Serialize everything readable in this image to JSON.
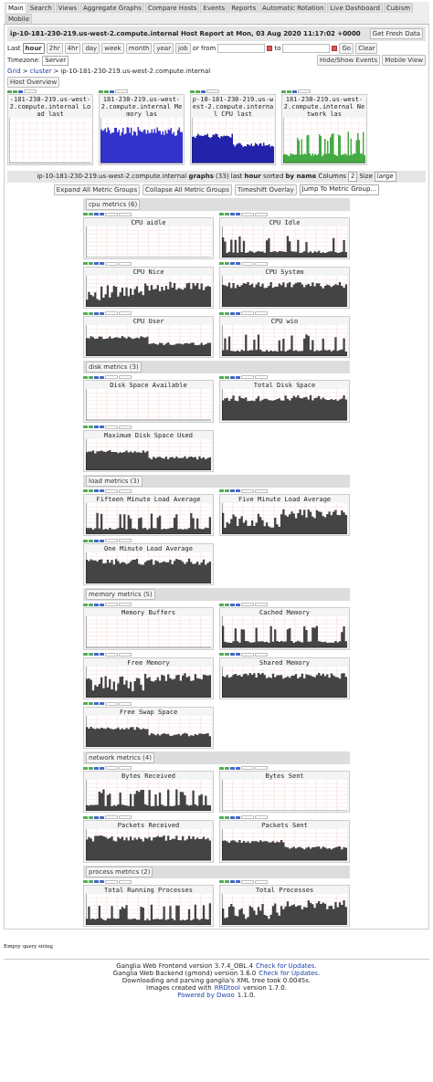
{
  "tabs": [
    {
      "label": "Main",
      "selected": true
    },
    {
      "label": "Search",
      "selected": false
    },
    {
      "label": "Views",
      "selected": false
    },
    {
      "label": "Aggregate Graphs",
      "selected": false
    },
    {
      "label": "Compare Hosts",
      "selected": false
    },
    {
      "label": "Events",
      "selected": false
    },
    {
      "label": "Reports",
      "selected": false
    },
    {
      "label": "Automatic Rotation",
      "selected": false
    },
    {
      "label": "Live Dashboard",
      "selected": false
    },
    {
      "label": "Cubism",
      "selected": false
    },
    {
      "label": "Mobile",
      "selected": false
    }
  ],
  "header": {
    "title": "ip-10-181-230-219.us-west-2.compute.internal Host Report at Mon, 03 Aug 2020 11:17:02 +0000",
    "refresh_button": "Get Fresh Data"
  },
  "range": {
    "label": "Last",
    "options": [
      {
        "label": "hour",
        "selected": true
      },
      {
        "label": "2hr",
        "selected": false
      },
      {
        "label": "4hr",
        "selected": false
      },
      {
        "label": "day",
        "selected": false
      },
      {
        "label": "week",
        "selected": false
      },
      {
        "label": "month",
        "selected": false
      },
      {
        "label": "year",
        "selected": false
      },
      {
        "label": "job",
        "selected": false
      }
    ],
    "from_label": "or from",
    "to_label": "to",
    "go_button": "Go",
    "clear_button": "Clear",
    "timezone_label": "Timezone:",
    "timezone": "Server",
    "events_button": "Hide/Show Events",
    "mobile_button": "Mobile View"
  },
  "breadcrumb": {
    "items": [
      "Grid",
      "cluster",
      "ip-10-181-230-219.us-west-2.compute.internal"
    ],
    "separator": ">"
  },
  "overview": {
    "button": "Host Overview",
    "graphs": [
      {
        "title": "-181-230-219.us-west-2.compute.internal Load last"
      },
      {
        "title": "181-230-219.us-west-2.compute.internal Memory las"
      },
      {
        "title": "p-10-181-230-219.us-west-2.compute.internal CPU last"
      },
      {
        "title": "181-230-219.us-west-2.compute.internal Network las"
      }
    ]
  },
  "graphs_bar": {
    "text": "ip-10-181-230-219.us-west-2.compute.internal **graphs** (33) last **hour** sorted **by name** Columns",
    "columns": "2",
    "size_label": "Size",
    "size": "large"
  },
  "group_buttons": [
    "Expand All Metric Groups",
    "Collapse All Metric Groups",
    "Timeshift Overlay"
  ],
  "jump_select": "Jump To Metric Group...",
  "groups": [
    {
      "title": "cpu metrics (6)",
      "graphs": [
        {
          "title": "CPU aidle"
        },
        {
          "title": "CPU Idle"
        },
        {
          "title": "CPU Nice"
        },
        {
          "title": "CPU System"
        },
        {
          "title": "CPU User"
        },
        {
          "title": "CPU wio"
        }
      ]
    },
    {
      "title": "disk metrics (3)",
      "graphs": [
        {
          "title": "Disk Space Available"
        },
        {
          "title": "Total Disk Space"
        },
        {
          "title": "Maximum Disk Space Used"
        }
      ]
    },
    {
      "title": "load metrics (3)",
      "graphs": [
        {
          "title": "Fifteen Minute Load Average"
        },
        {
          "title": "Five Minute Load Average"
        },
        {
          "title": "One Minute Load Average"
        }
      ]
    },
    {
      "title": "memory metrics (5)",
      "graphs": [
        {
          "title": "Memory Buffers"
        },
        {
          "title": "Cached Memory"
        },
        {
          "title": "Free Memory"
        },
        {
          "title": "Shared Memory"
        },
        {
          "title": "Free Swap Space"
        }
      ]
    },
    {
      "title": "network metrics (4)",
      "graphs": [
        {
          "title": "Bytes Received"
        },
        {
          "title": "Bytes Sent"
        },
        {
          "title": "Packets Received"
        },
        {
          "title": "Packets Sent"
        }
      ]
    },
    {
      "title": "process metrics (2)",
      "graphs": [
        {
          "title": "Total Running Processes"
        },
        {
          "title": "Total Processes"
        }
      ]
    }
  ],
  "empty_message": "Empty query string",
  "footer": [
    {
      "before": "Ganglia Web Frontend version 3.7.4_OBL.4",
      "link": "Check for Updates."
    },
    {
      "before": "Ganglia Web Backend (gmond) version 3.6.0",
      "link": "Check for Updates."
    },
    {
      "before": "Downloading and parsing ganglia's XML tree took 0.0045s."
    },
    {
      "before": "Images created with",
      "link": "RRDtool",
      "after": "version 1.7.0."
    },
    {
      "link": "Powered by Dwoo",
      "after": "1.1.0."
    }
  ]
}
